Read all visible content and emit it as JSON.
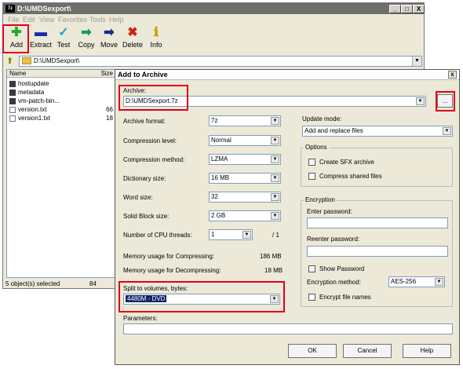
{
  "main_window": {
    "title": "D:\\UMDSexport\\",
    "app_icon": "7z",
    "controls": {
      "minimize": "_",
      "maximize": "□",
      "close": "X"
    },
    "menu": [
      "File",
      "Edit",
      "View",
      "Favorites",
      "Tools",
      "Help"
    ],
    "toolbar": [
      {
        "label": "Add",
        "icon": "add-plus-icon",
        "glyph": "✚",
        "color": "#22aa22"
      },
      {
        "label": "Extract",
        "icon": "extract-icon",
        "glyph": "▬",
        "color": "#1a2aa8"
      },
      {
        "label": "Test",
        "icon": "test-check-icon",
        "glyph": "✓",
        "color": "#1aa8c8"
      },
      {
        "label": "Copy",
        "icon": "copy-arrow-icon",
        "glyph": "➡",
        "color": "#1a9a5a"
      },
      {
        "label": "Move",
        "icon": "move-arrow-icon",
        "glyph": "➡",
        "color": "#1a2a88"
      },
      {
        "label": "Delete",
        "icon": "delete-x-icon",
        "glyph": "✖",
        "color": "#d0201a"
      },
      {
        "label": "Info",
        "icon": "info-icon",
        "glyph": "ℹ",
        "color": "#c8a000"
      }
    ],
    "address": {
      "path": "D:\\UMDSexport\\"
    },
    "file_list": {
      "columns": {
        "name": "Name",
        "size": "Size"
      },
      "rows": [
        {
          "name": "hostupdate",
          "size": "",
          "type": "folder"
        },
        {
          "name": "metadata",
          "size": "",
          "type": "folder"
        },
        {
          "name": "vm-patch-bin...",
          "size": "",
          "type": "folder"
        },
        {
          "name": "version.txt",
          "size": "66",
          "type": "file"
        },
        {
          "name": "version1.txt",
          "size": "18",
          "type": "file"
        }
      ]
    },
    "status": {
      "selected": "5 object(s) selected",
      "size": "84"
    }
  },
  "dialog": {
    "title": "Add to Archive",
    "close": "x",
    "archive": {
      "label": "Archive:",
      "value": "D:\\UMDSexport.7z",
      "browse": "..."
    },
    "left_fields": [
      {
        "label": "Archive format:",
        "value": "7z"
      },
      {
        "label": "Compression level:",
        "value": "Normal"
      },
      {
        "label": "Compression method:",
        "value": "LZMA"
      },
      {
        "label": "Dictionary size:",
        "value": "16 MB"
      },
      {
        "label": "Word size:",
        "value": "32"
      },
      {
        "label": "Solid Block size:",
        "value": "2 GB"
      }
    ],
    "cpu_threads": {
      "label": "Number of CPU threads:",
      "value": "1",
      "max": "/ 1"
    },
    "memory": {
      "compress_label": "Memory usage for Compressing:",
      "compress_value": "186 MB",
      "decompress_label": "Memory usage for Decompressing:",
      "decompress_value": "18 MB"
    },
    "split": {
      "label": "Split to volumes, bytes:",
      "value": "4480M - DVD"
    },
    "parameters": {
      "label": "Parameters:",
      "value": ""
    },
    "update_mode": {
      "label": "Update mode:",
      "value": "Add and replace files"
    },
    "options": {
      "title": "Options",
      "sfx": "Create SFX archive",
      "shared": "Compress shared files"
    },
    "encryption": {
      "title": "Encryption",
      "enter_password": "Enter password:",
      "reenter_password": "Reenter password:",
      "show_password": "Show Password",
      "method_label": "Encryption method:",
      "method_value": "AES-256",
      "encrypt_names": "Encrypt file names"
    },
    "buttons": {
      "ok": "OK",
      "cancel": "Cancel",
      "help": "Help"
    }
  },
  "highlight_color": "#e0001a"
}
